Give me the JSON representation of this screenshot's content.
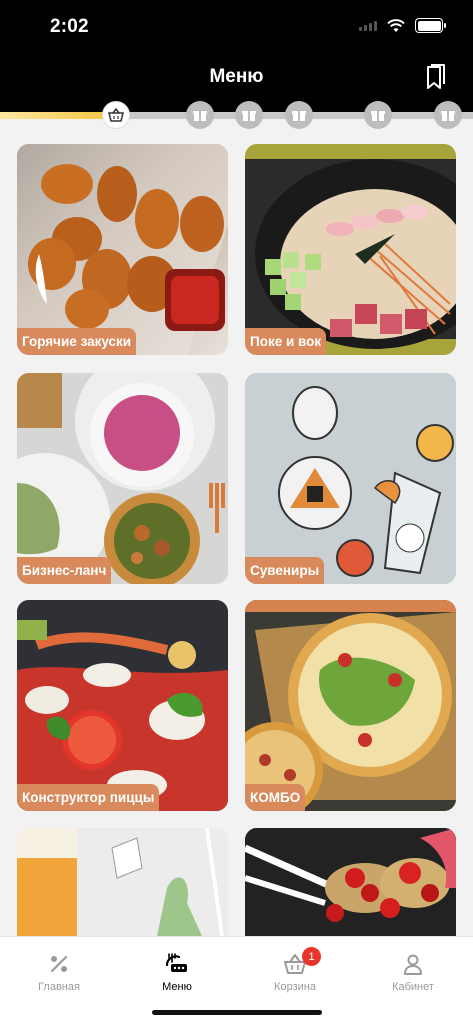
{
  "status_bar": {
    "time": "2:02"
  },
  "header": {
    "title": "Меню"
  },
  "progress": {
    "fraction": 0.22
  },
  "categories": [
    {
      "label": "Горячие закуски"
    },
    {
      "label": "Поке и вок"
    },
    {
      "label": "Бизнес-ланч"
    },
    {
      "label": "Сувениры"
    },
    {
      "label": "Конструктор пиццы"
    },
    {
      "label": "КОМБО"
    },
    {
      "label": ""
    },
    {
      "label": ""
    }
  ],
  "bottom_nav": {
    "items": [
      {
        "label": "Главная",
        "icon": "percent-icon"
      },
      {
        "label": "Меню",
        "icon": "menu-food-icon"
      },
      {
        "label": "Корзина",
        "icon": "basket-icon",
        "badge": "1"
      },
      {
        "label": "Кабинет",
        "icon": "user-icon"
      }
    ]
  },
  "colors": {
    "accent": "#d98a5c",
    "badge": "#e8362f",
    "progress": "#f6c74a"
  }
}
